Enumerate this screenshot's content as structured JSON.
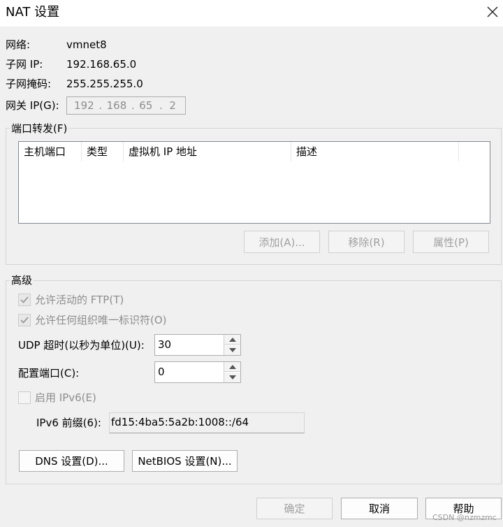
{
  "window": {
    "title": "NAT 设置"
  },
  "info": {
    "network_label": "网络:",
    "network_value": "vmnet8",
    "subnet_ip_label": "子网 IP:",
    "subnet_ip_value": "192.168.65.0",
    "subnet_mask_label": "子网掩码:",
    "subnet_mask_value": "255.255.255.0",
    "gateway_label": "网关 IP(G):",
    "gateway_octets": [
      "192",
      "168",
      "65",
      "2"
    ]
  },
  "port_forwarding": {
    "title": "端口转发(F)",
    "columns": [
      "主机端口",
      "类型",
      "虚拟机 IP 地址",
      "描述"
    ],
    "rows": [],
    "add_label": "添加(A)...",
    "remove_label": "移除(R)",
    "properties_label": "属性(P)"
  },
  "advanced": {
    "title": "高级",
    "allow_ftp_label": "允许活动的 FTP(T)",
    "allow_ftp_checked": true,
    "allow_oui_label": "允许任何组织唯一标识符(O)",
    "allow_oui_checked": true,
    "udp_timeout_label": "UDP 超时(以秒为单位)(U):",
    "udp_timeout_value": "30",
    "config_port_label": "配置端口(C):",
    "config_port_value": "0",
    "enable_ipv6_label": "启用 IPv6(E)",
    "enable_ipv6_checked": false,
    "ipv6_prefix_label": "IPv6 前缀(6):",
    "ipv6_prefix_value": "fd15:4ba5:5a2b:1008::/64",
    "dns_label": "DNS 设置(D)...",
    "netbios_label": "NetBIOS 设置(N)..."
  },
  "footer": {
    "ok_label": "确定",
    "cancel_label": "取消",
    "help_label": "帮助"
  },
  "watermark": "CSDN @nzmzmc",
  "icons": {
    "close": "close-icon",
    "check": "checkmark-icon",
    "spin_up": "triangle-up-icon",
    "spin_down": "triangle-down-icon"
  }
}
